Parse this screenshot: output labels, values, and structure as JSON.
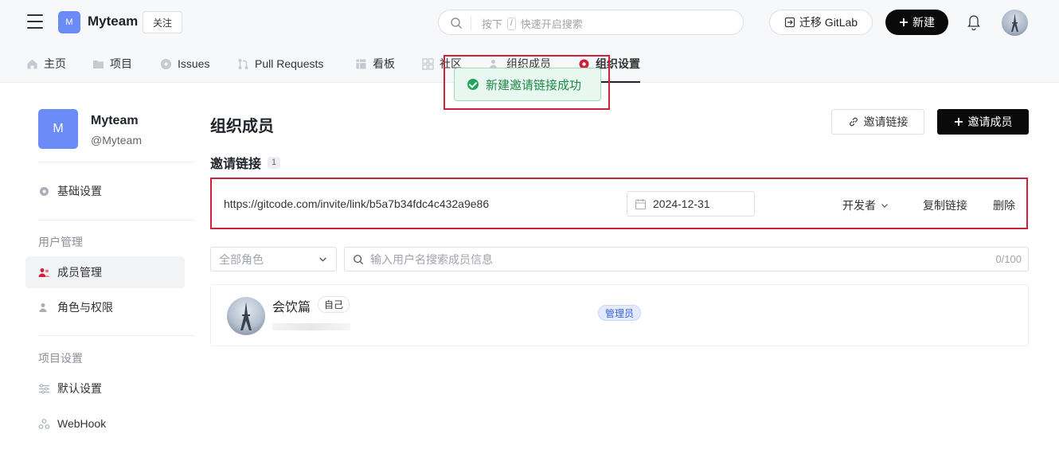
{
  "header": {
    "org_avatar_letter": "M",
    "org_name": "Myteam",
    "follow_label": "关注",
    "search_hint_prefix": "按下",
    "search_hint_key": "/",
    "search_hint_suffix": "快速开启搜索",
    "gitlab_label": "迁移 GitLab",
    "new_label": "新建"
  },
  "nav": {
    "items": [
      {
        "label": "主页"
      },
      {
        "label": "项目"
      },
      {
        "label": "Issues"
      },
      {
        "label": "Pull Requests"
      },
      {
        "label": "看板"
      },
      {
        "label": "社区"
      },
      {
        "label": "组织成员"
      },
      {
        "label": "组织设置"
      }
    ]
  },
  "toast": {
    "message": "新建邀请链接成功"
  },
  "sidebar": {
    "avatar_letter": "M",
    "name": "Myteam",
    "handle": "@Myteam",
    "basic_settings": "基础设置",
    "group_user": "用户管理",
    "member_mgmt": "成员管理",
    "role_perm": "角色与权限",
    "group_project": "项目设置",
    "default_settings": "默认设置",
    "webhook": "WebHook"
  },
  "main": {
    "title": "组织成员",
    "invite_link_btn": "邀请链接",
    "invite_member_btn": "邀请成员",
    "section_title": "邀请链接",
    "section_count": "1",
    "link": {
      "url": "https://gitcode.com/invite/link/b5a7b34fdc4c432a9e86",
      "date": "2024-12-31",
      "role": "开发者",
      "copy": "复制链接",
      "delete": "删除"
    },
    "role_filter": "全部角色",
    "search_placeholder": "输入用户名搜索成员信息",
    "search_counter": "0/100",
    "member": {
      "name": "会饮篇",
      "self_label": "自己",
      "role_badge": "管理员"
    }
  },
  "colors": {
    "accent_red": "#d0213a",
    "avatar_blue": "#6b8cf7",
    "success_green": "#22a559",
    "admin_blue": "#3b63d9"
  }
}
